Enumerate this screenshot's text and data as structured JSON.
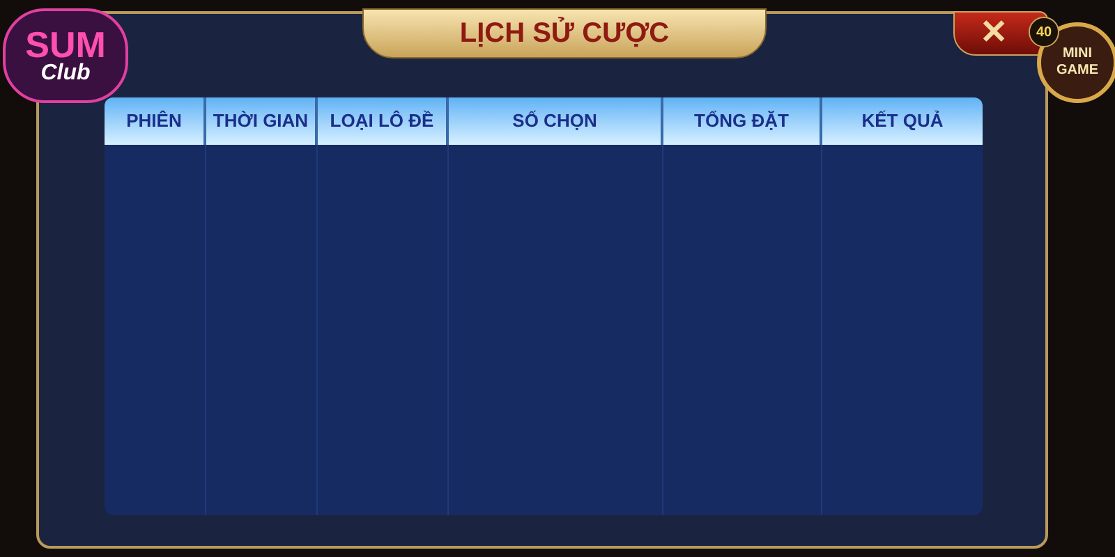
{
  "logo": {
    "title": "SUM",
    "subtitle": "Club"
  },
  "dialog": {
    "title": "LỊCH SỬ CƯỢC"
  },
  "close_button": {
    "label": "✕"
  },
  "mini_game": {
    "label": "MINI GAME",
    "badge": "40"
  },
  "table": {
    "columns": [
      {
        "label": "PHIÊN"
      },
      {
        "label": "THỜI GIAN"
      },
      {
        "label": "LOẠI LÔ ĐỀ"
      },
      {
        "label": "SỐ CHỌN"
      },
      {
        "label": "TỔNG ĐẶT"
      },
      {
        "label": "KẾT QUẢ"
      }
    ]
  }
}
